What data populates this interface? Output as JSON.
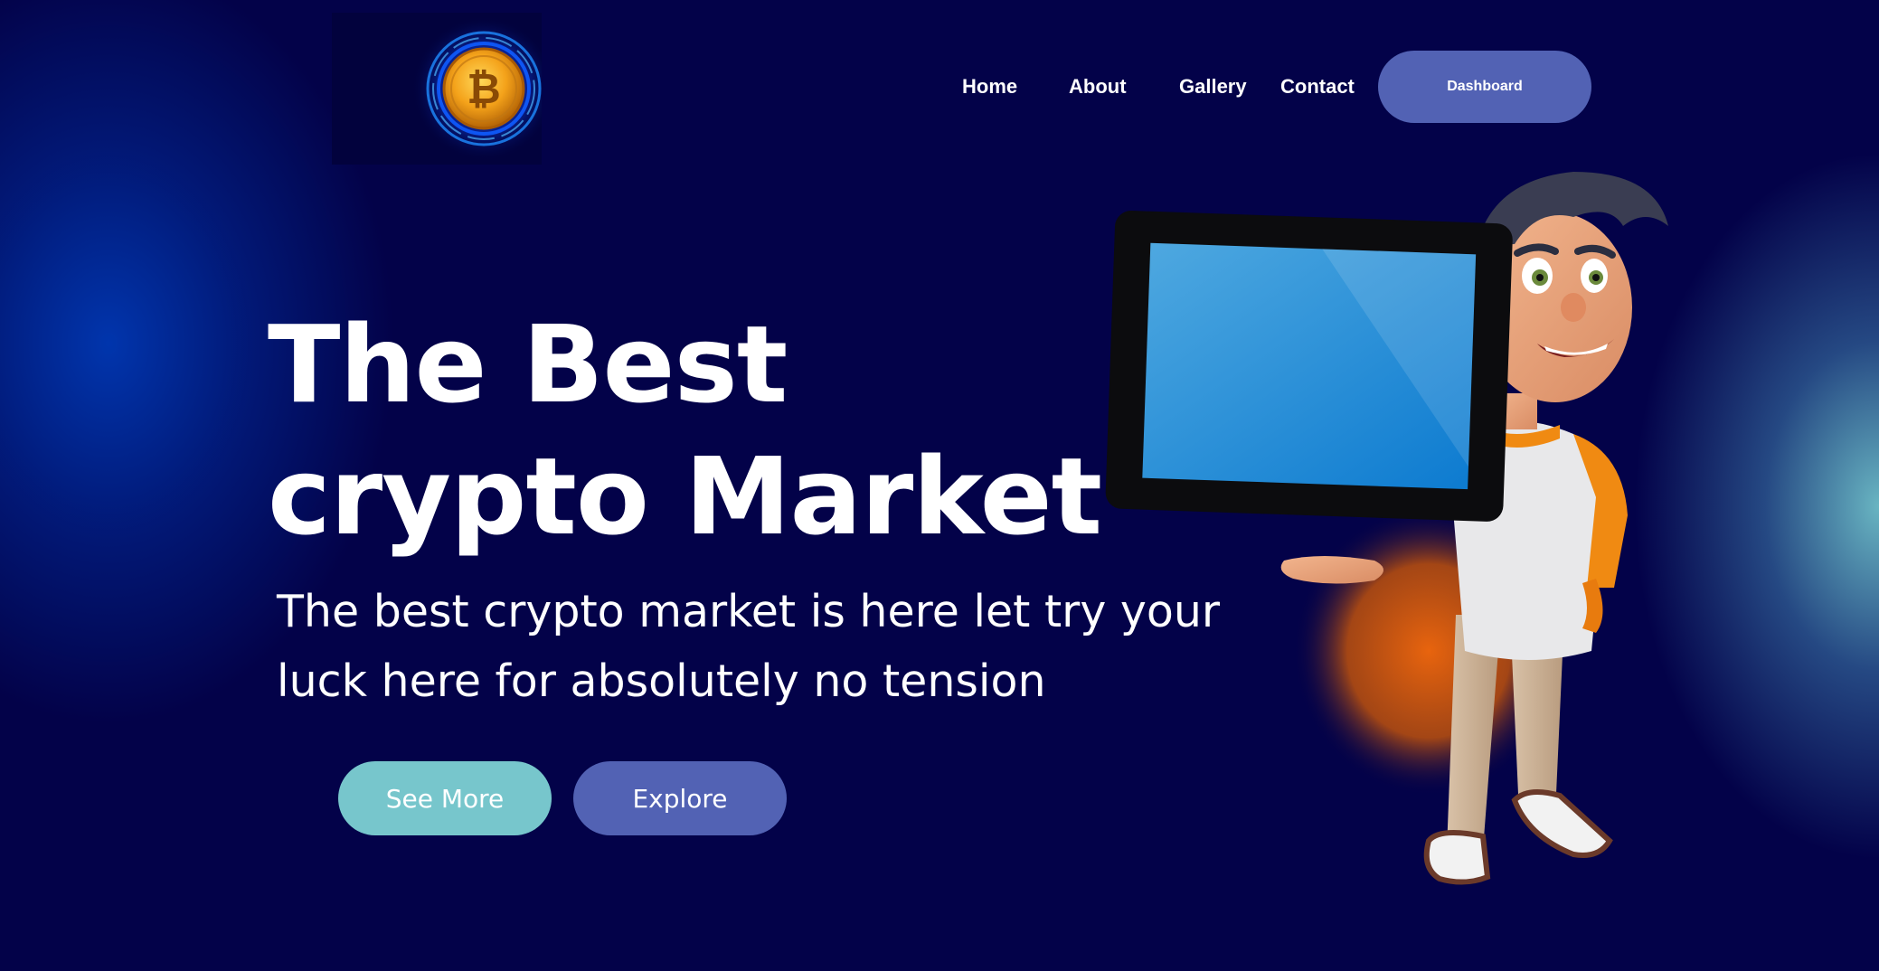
{
  "brand": {
    "logo": "bitcoin-coin-logo"
  },
  "nav": {
    "items": [
      {
        "label": "Home"
      },
      {
        "label": "About"
      },
      {
        "label": "Gallery"
      },
      {
        "label": "Contact"
      }
    ],
    "cta_label": "Dashboard"
  },
  "hero": {
    "title_line1": "The Best",
    "title_line2": "crypto Market",
    "subtitle_line1": "The best crypto market is here let try your",
    "subtitle_line2": "luck here for absolutely no tension",
    "buttons": {
      "see_more": "See More",
      "explore": "Explore"
    },
    "illustration": "cartoon-boy-holding-tablet"
  },
  "colors": {
    "background": "#030249",
    "accent_primary": "#5262b4",
    "accent_secondary": "#77c6cc",
    "glow_orange": "#e8640e",
    "text": "#ffffff"
  }
}
